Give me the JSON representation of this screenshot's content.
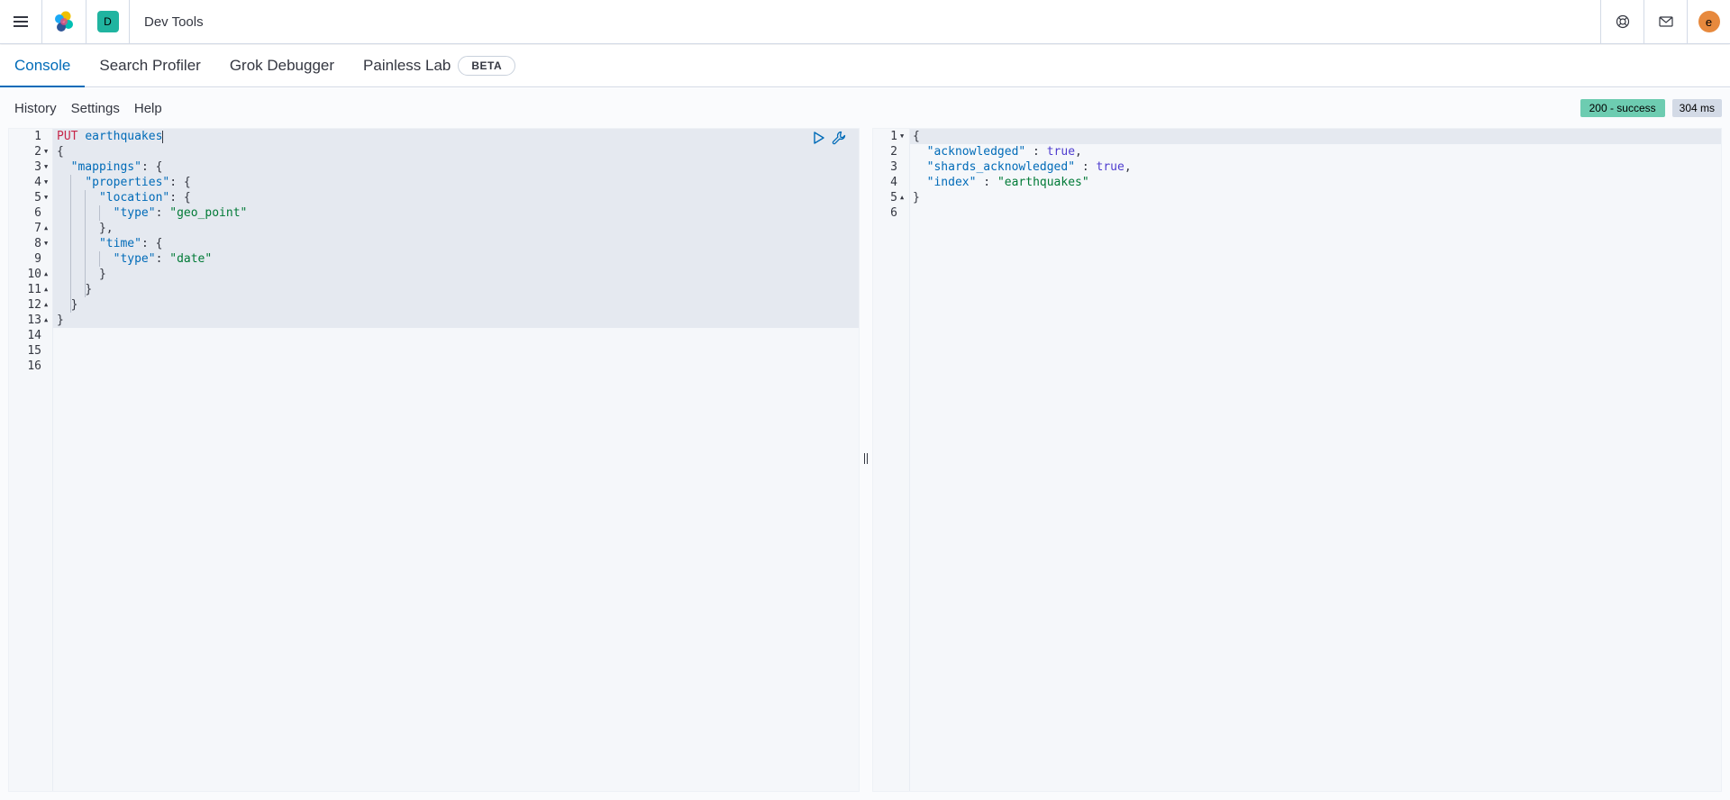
{
  "header": {
    "menu_icon": "hamburger-menu-icon",
    "logo_icon": "elastic-logo-icon",
    "space_initial": "D",
    "breadcrumb": "Dev Tools",
    "help_icon": "help-lifebuoy-icon",
    "news_icon": "newsfeed-mail-icon",
    "user_initial": "e"
  },
  "tabs": [
    {
      "label": "Console",
      "active": true
    },
    {
      "label": "Search Profiler",
      "active": false
    },
    {
      "label": "Grok Debugger",
      "active": false
    },
    {
      "label": "Painless Lab",
      "active": false,
      "badge": "BETA"
    }
  ],
  "console_bar": {
    "history": "History",
    "settings": "Settings",
    "help": "Help",
    "status": "200 - success",
    "time": "304 ms"
  },
  "request": {
    "method": "PUT",
    "path": "earthquakes",
    "line_numbers": [
      "1",
      "2",
      "3",
      "4",
      "5",
      "6",
      "7",
      "8",
      "9",
      "10",
      "11",
      "12",
      "13",
      "14",
      "15",
      "16"
    ],
    "lines": [
      "",
      "{",
      "  \"mappings\": {",
      "    \"properties\": {",
      "      \"location\": {",
      "        \"type\": \"geo_point\"",
      "      },",
      "      \"time\": {",
      "        \"type\": \"date\"",
      "      }",
      "    }",
      "  }",
      "}",
      "",
      "",
      ""
    ]
  },
  "response": {
    "line_numbers": [
      "1",
      "2",
      "3",
      "4",
      "5",
      "6"
    ],
    "lines": [
      "{",
      "  \"acknowledged\" : true,",
      "  \"shards_acknowledged\" : true,",
      "  \"index\" : \"earthquakes\"",
      "}",
      ""
    ]
  },
  "colors": {
    "accent": "#006bb8",
    "success_badge": "#6dccb1",
    "method": "#c7274a",
    "string": "#007a36",
    "boolean": "#4e3ccf"
  }
}
